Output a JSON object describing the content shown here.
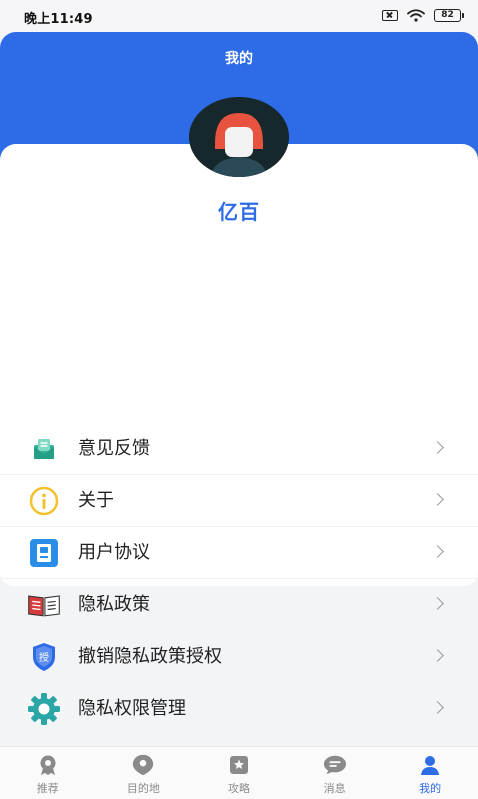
{
  "status_bar": {
    "time": "晚上11:49",
    "battery": "82"
  },
  "header": {
    "title": "我的"
  },
  "profile": {
    "username": "亿百"
  },
  "menu": {
    "items": [
      {
        "label": "意见反馈",
        "icon": "feedback-mail-icon",
        "color": "#2fb397"
      },
      {
        "label": "关于",
        "icon": "info-icon",
        "color": "#f2c230"
      },
      {
        "label": "用户协议",
        "icon": "user-agreement-icon",
        "color": "#2a8ee6"
      },
      {
        "label": "隐私政策",
        "icon": "privacy-book-icon",
        "color": "#d63b3b"
      },
      {
        "label": "撤销隐私政策授权",
        "icon": "revoke-shield-icon",
        "color": "#2e6be6"
      },
      {
        "label": "隐私权限管理",
        "icon": "gear-icon",
        "color": "#2aa6a6"
      }
    ]
  },
  "tabbar": {
    "items": [
      {
        "label": "推荐",
        "icon": "recommend-icon"
      },
      {
        "label": "目的地",
        "icon": "location-icon"
      },
      {
        "label": "攻略",
        "icon": "guide-icon"
      },
      {
        "label": "消息",
        "icon": "message-icon"
      },
      {
        "label": "我的",
        "icon": "profile-icon",
        "active": true
      }
    ]
  },
  "colors": {
    "accent": "#2e6be6",
    "inactive_tab": "#8a8a8a"
  }
}
